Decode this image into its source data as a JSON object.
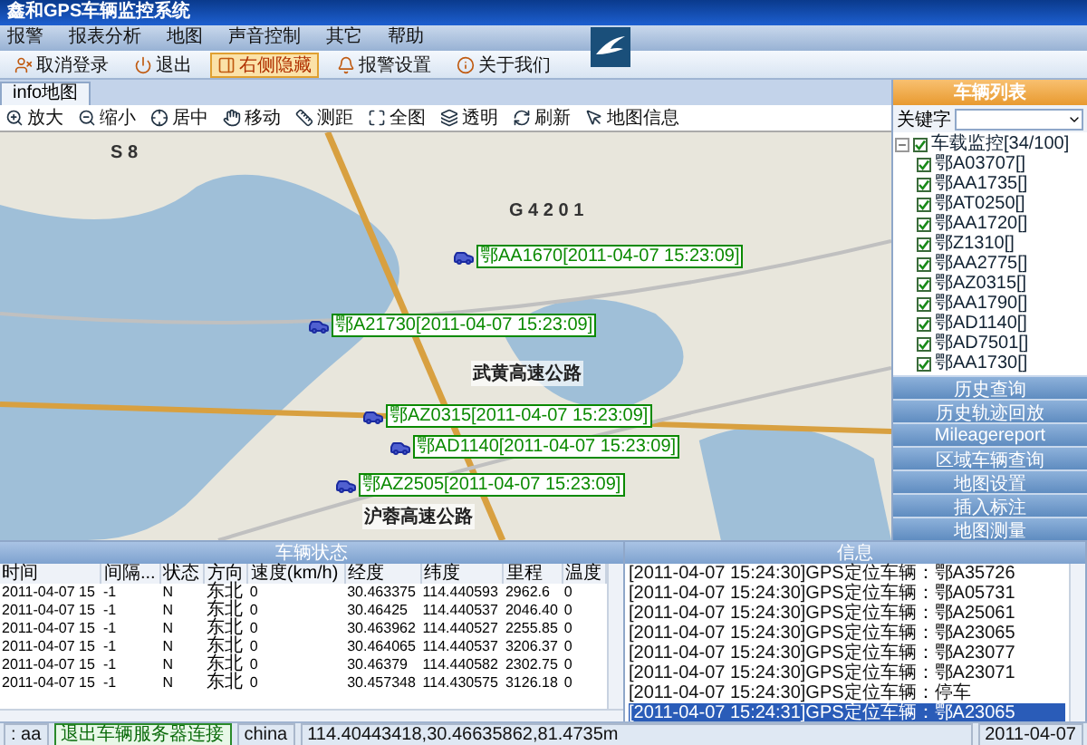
{
  "window": {
    "title": "鑫和GPS车辆监控系统"
  },
  "menu": [
    "报警",
    "报表分析",
    "地图",
    "声音控制",
    "其它",
    "帮助"
  ],
  "toolbar": [
    {
      "label": "取消登录",
      "selected": false
    },
    {
      "label": "退出",
      "selected": false
    },
    {
      "label": "右侧隐藏",
      "selected": true
    },
    {
      "label": "报警设置",
      "selected": false
    },
    {
      "label": "关于我们",
      "selected": false
    }
  ],
  "map_tab": {
    "label": "info地图"
  },
  "map_toolbar": [
    "放大",
    "缩小",
    "居中",
    "移动",
    "测距",
    "全图",
    "透明",
    "刷新",
    "地图信息"
  ],
  "map": {
    "labels": [
      {
        "text": "S 8",
        "kind": "road"
      },
      {
        "text": "G 4 2 0 1",
        "kind": "road"
      },
      {
        "text": "武黄高速公路",
        "kind": "highway"
      },
      {
        "text": "沪蓉高速公路",
        "kind": "highway"
      }
    ],
    "vehicles": [
      {
        "label": "鄂AA1670[2011-04-07 15:23:09]"
      },
      {
        "label": "鄂A21730[2011-04-07 15:23:09]"
      },
      {
        "label": "鄂AZ0315[2011-04-07 15:23:09]"
      },
      {
        "label": "鄂AD1140[2011-04-07 15:23:09]"
      },
      {
        "label": "鄂AZ2505[2011-04-07 15:23:09]"
      }
    ]
  },
  "sidebar": {
    "title": "车辆列表",
    "keyword_label": "关键字",
    "tree": {
      "label": "车载监控[34/100]",
      "checked": true,
      "expanded": true,
      "children": [
        {
          "label": "鄂A03707[]",
          "checked": true
        },
        {
          "label": "鄂AA1735[]",
          "checked": true
        },
        {
          "label": "鄂AT0250[]",
          "checked": true
        },
        {
          "label": "鄂AA1720[]",
          "checked": true
        },
        {
          "label": "鄂Z1310[]",
          "checked": true
        },
        {
          "label": "鄂AA2775[]",
          "checked": true
        },
        {
          "label": "鄂AZ0315[]",
          "checked": true
        },
        {
          "label": "鄂AA1790[]",
          "checked": true
        },
        {
          "label": "鄂AD1140[]",
          "checked": true
        },
        {
          "label": "鄂AD7501[]",
          "checked": true
        },
        {
          "label": "鄂AA1730[]",
          "checked": true
        }
      ]
    },
    "buttons": [
      "历史查询",
      "历史轨迹回放",
      "Mileagereport",
      "区域车辆查询",
      "地图设置",
      "插入标注",
      "地图测量"
    ]
  },
  "vehicle_status": {
    "title": "车辆状态",
    "columns": [
      "时间",
      "间隔...",
      "状态",
      "方向",
      "速度(km/h)",
      "经度",
      "纬度",
      "里程",
      "温度"
    ],
    "rows": [
      [
        "2011-04-07 15",
        "-1",
        "N",
        "东北",
        "0",
        "30.463375",
        "114.440593",
        "2962.6",
        "0"
      ],
      [
        "2011-04-07 15",
        "-1",
        "N",
        "东北",
        "0",
        "30.46425",
        "114.440537",
        "2046.40",
        "0"
      ],
      [
        "2011-04-07 15",
        "-1",
        "N",
        "东北",
        "0",
        "30.463962",
        "114.440527",
        "2255.85",
        "0"
      ],
      [
        "2011-04-07 15",
        "-1",
        "N",
        "东北",
        "0",
        "30.464065",
        "114.440537",
        "3206.37",
        "0"
      ],
      [
        "2011-04-07 15",
        "-1",
        "N",
        "东北",
        "0",
        "30.46379",
        "114.440582",
        "2302.75",
        "0"
      ],
      [
        "2011-04-07 15",
        "-1",
        "N",
        "东北",
        "0",
        "30.457348",
        "114.430575",
        "3126.18",
        "0"
      ]
    ]
  },
  "info": {
    "title": "信息",
    "entries": [
      {
        "text": "[2011-04-07 15:24:30]GPS定位车辆：鄂A35726",
        "selected": false
      },
      {
        "text": "[2011-04-07 15:24:30]GPS定位车辆：鄂A05731",
        "selected": false
      },
      {
        "text": "[2011-04-07 15:24:30]GPS定位车辆：鄂A25061",
        "selected": false
      },
      {
        "text": "[2011-04-07 15:24:30]GPS定位车辆：鄂A23065",
        "selected": false
      },
      {
        "text": "[2011-04-07 15:24:30]GPS定位车辆：鄂A23077",
        "selected": false
      },
      {
        "text": "[2011-04-07 15:24:30]GPS定位车辆：鄂A23071",
        "selected": false
      },
      {
        "text": "[2011-04-07 15:24:30]GPS定位车辆：停车",
        "selected": false
      },
      {
        "text": "[2011-04-07 15:24:31]GPS定位车辆：鄂A23065",
        "selected": true
      }
    ]
  },
  "status_bar": [
    ": aa",
    "退出车辆服务器连接",
    "china",
    "114.40443418,30.46635862,81.4735m",
    "2011-04-07"
  ]
}
